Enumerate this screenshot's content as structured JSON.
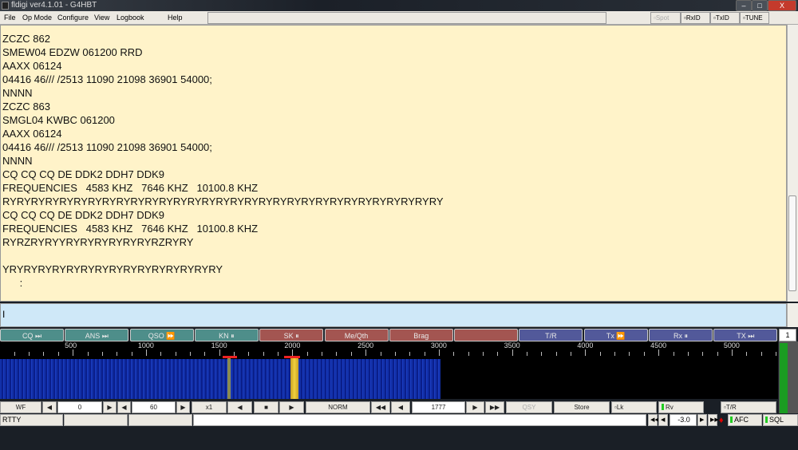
{
  "window": {
    "title": "fldigi ver4.1.01 - G4HBT",
    "minimize": "–",
    "maximize": "□",
    "close": "X"
  },
  "menu": [
    "File",
    "Op Mode",
    "Configure",
    "View",
    "Logbook",
    "Help"
  ],
  "toggles": {
    "spot": "Spot",
    "rxid": "RxID",
    "txid": "TxID",
    "tune": "TUNE"
  },
  "rx_lines": [
    "ZCZC 862",
    "SMEW04 EDZW 061200 RRD",
    "AAXX 06124",
    "04416 46/// /2513 11090 21098 36901 54000;",
    "NNNN",
    "ZCZC 863",
    "SMGL04 KWBC 061200",
    "AAXX 06124",
    "04416 46/// /2513 11090 21098 36901 54000;",
    "NNNN",
    "CQ CQ CQ DE DDK2 DDH7 DDK9",
    "FREQUENCIES   4583 KHZ   7646 KHZ   10100.8 KHZ",
    "RYRYRYRYRYRYRYRYRYRYRYRYRYRYRYRYRYRYRYRYRYRYRYRYRYRYRYRYRYRYRY",
    "CQ CQ CQ DE DDK2 DDH7 DDK9",
    "FREQUENCIES   4583 KHZ   7646 KHZ   10100.8 KHZ",
    "RYRZRYRYYRYRYRYRYRYRYRZRYRY",
    "",
    "YRYRYRYRYRYRYRYRYRYRYRYRYRYRYRY",
    "      :"
  ],
  "tx_text": "I",
  "macros": [
    {
      "label": "CQ ⏭",
      "c": "teal"
    },
    {
      "label": "ANS ⏭",
      "c": "teal"
    },
    {
      "label": "QSO ⏩",
      "c": "teal"
    },
    {
      "label": "KN ⏸",
      "c": "teal"
    },
    {
      "label": "SK ⏸",
      "c": "red"
    },
    {
      "label": "Me/Qth",
      "c": "red"
    },
    {
      "label": "Brag",
      "c": "red"
    },
    {
      "label": "",
      "c": "red"
    },
    {
      "label": "T/R",
      "c": "blue"
    },
    {
      "label": "Tx ⏩",
      "c": "blue"
    },
    {
      "label": "Rx ⏸",
      "c": "blue"
    },
    {
      "label": "TX ⏭",
      "c": "blue"
    }
  ],
  "macro_set": "1",
  "scale_labels": [
    "500",
    "1000",
    "1500",
    "2000",
    "2500",
    "3000",
    "3500",
    "4000",
    "4500",
    "5000"
  ],
  "controls": {
    "wf": "WF",
    "offset": "0",
    "speed": "60",
    "zoom": "x1",
    "mode": "NORM",
    "freq": "1777",
    "qsy": "QSY",
    "store": "Store",
    "lk": "Lk",
    "rv": "Rv",
    "tr": "T/R"
  },
  "status": {
    "mode": "RTTY",
    "squelch": "-3.0",
    "afc": "AFC",
    "sql": "SQL"
  }
}
